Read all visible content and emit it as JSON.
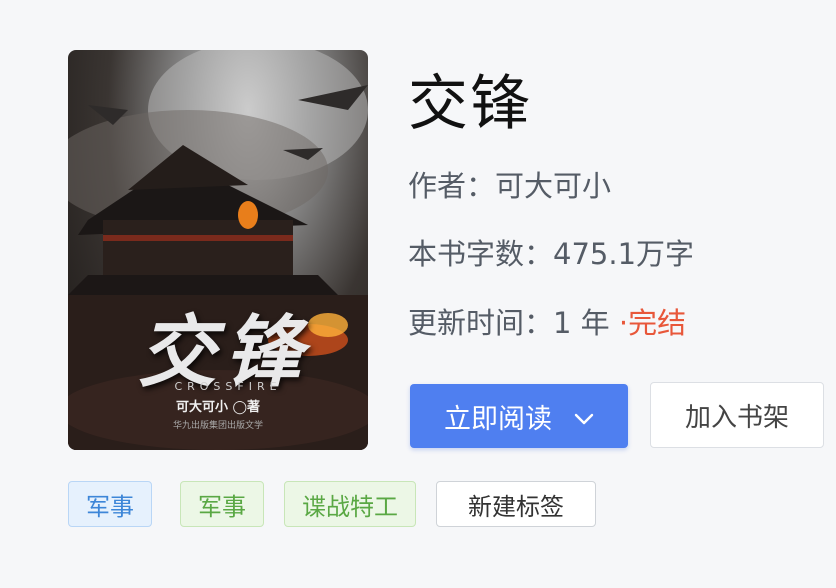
{
  "book": {
    "title": "交锋",
    "author_label": "作者：可大可小",
    "word_count_label": "本书字数：475.1万字",
    "update_prefix": "更新时间：1 年 ",
    "update_dot": "·",
    "status": "完结"
  },
  "cover": {
    "title": "交锋",
    "subtitle": "CROSSFIRE",
    "author": "可大可小 ◯著",
    "publisher": "华九出版集团出版文学",
    "colors": {
      "bg_dark": "#1a1614",
      "title": "#e9e9ea"
    }
  },
  "actions": {
    "read_label": "立即阅读",
    "shelf_label": "加入书架"
  },
  "tags": {
    "tag1": "军事",
    "tag2": "军事",
    "tag3": "谍战特工",
    "new_tag": "新建标签"
  },
  "colors": {
    "primary": "#4f7ff0",
    "status": "#e8573a",
    "tag_blue": "#3d86d8",
    "tag_green": "#5aa844"
  }
}
